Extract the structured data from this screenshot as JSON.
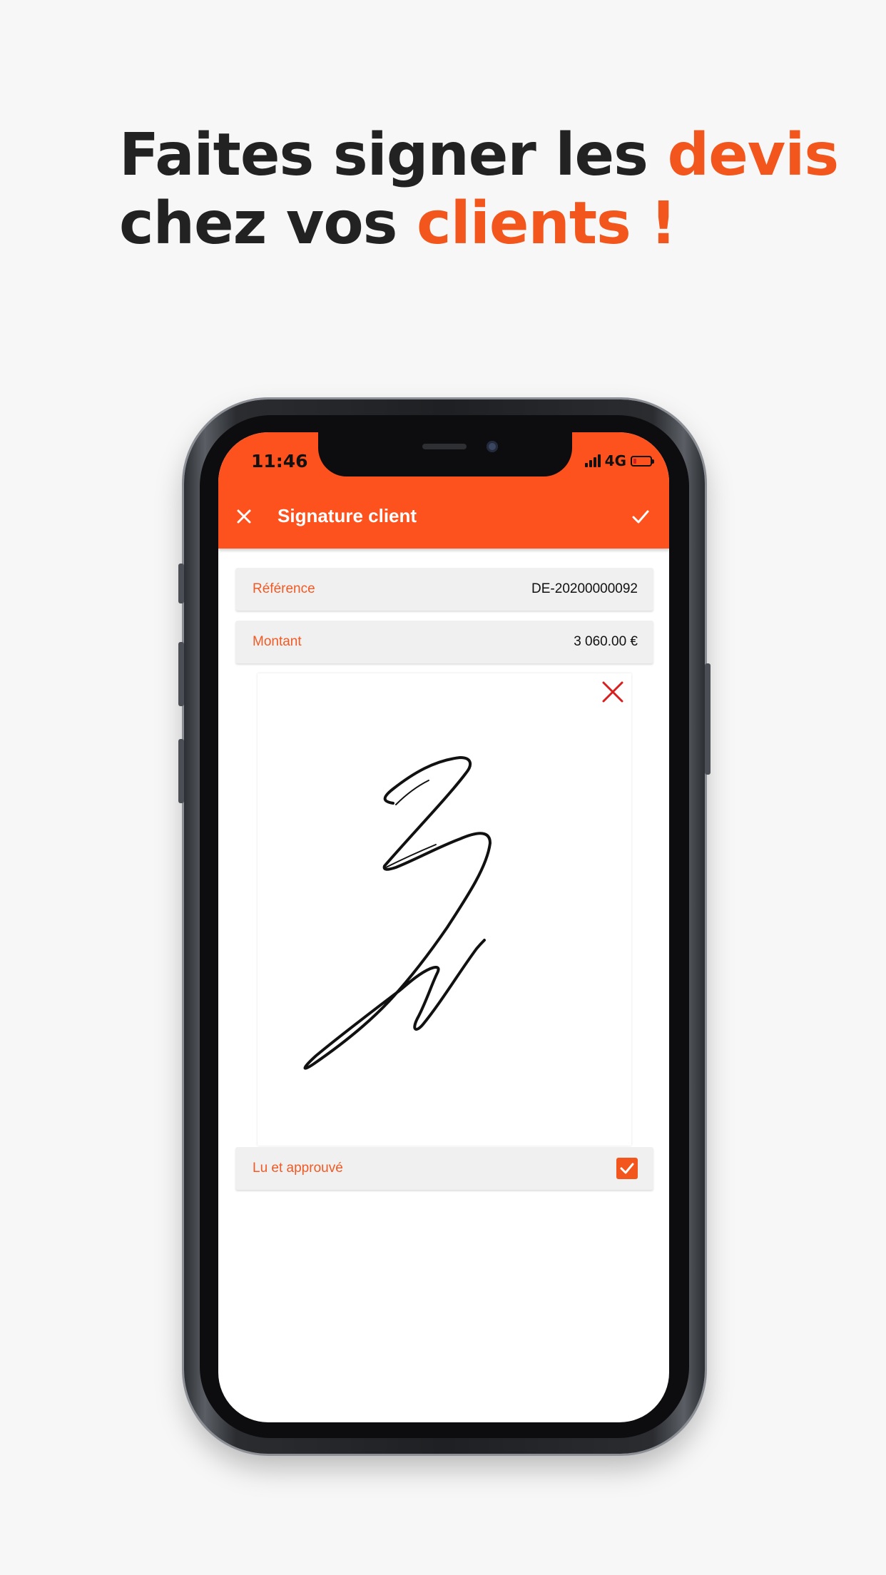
{
  "headline": {
    "line1_prefix": "Faites signer les ",
    "line1_accent": "devis",
    "line2_prefix": "chez vos ",
    "line2_accent": "clients !"
  },
  "status_bar": {
    "time": "11:46",
    "network": "4G",
    "signal_icon": "signal-bars-icon",
    "battery_icon": "battery-low-icon"
  },
  "app_bar": {
    "title": "Signature client",
    "close_icon": "close-icon",
    "confirm_icon": "check-icon"
  },
  "form": {
    "reference": {
      "label": "Référence",
      "value": "DE-20200000092"
    },
    "amount": {
      "label": "Montant",
      "value": "3 060.00 €"
    },
    "approval": {
      "label": "Lu et approuvé",
      "checked": true
    }
  },
  "signature_pad": {
    "clear_icon": "clear-signature-icon",
    "has_signature": true
  },
  "colors": {
    "accent": "#f2561d",
    "app_bar": "#fd521d",
    "clear_icon": "#d62020",
    "headline_text": "#222222"
  }
}
